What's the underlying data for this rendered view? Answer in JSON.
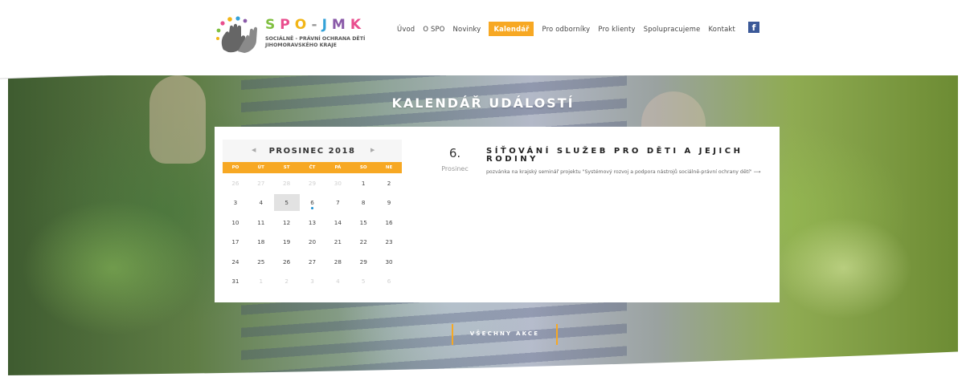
{
  "logo": {
    "title_letters": [
      "S",
      "P",
      "O",
      "-",
      "J",
      "M",
      "K"
    ],
    "subtitle_line1": "SOCIÁLNĚ - PRÁVNÍ OCHRANA DĚTÍ",
    "subtitle_line2": "JIHOMORAVSKÉHO KRAJE"
  },
  "nav": {
    "items": [
      "Úvod",
      "O SPO",
      "Novinky",
      "Kalendář",
      "Pro odborníky",
      "Pro klienty",
      "Spolupracujeme",
      "Kontakt"
    ],
    "active": "Kalendář",
    "facebook": "f"
  },
  "hero": {
    "title": "KALENDÁŘ UDÁLOSTÍ"
  },
  "calendar": {
    "title": "PROSINEC 2018",
    "prev": "◀",
    "next": "▶",
    "weekdays": [
      "PO",
      "ÚT",
      "ST",
      "ČT",
      "PÁ",
      "SO",
      "NE"
    ],
    "weeks": [
      [
        "26",
        "27",
        "28",
        "29",
        "30",
        "1",
        "2"
      ],
      [
        "3",
        "4",
        "5",
        "6",
        "7",
        "8",
        "9"
      ],
      [
        "10",
        "11",
        "12",
        "13",
        "14",
        "15",
        "16"
      ],
      [
        "17",
        "18",
        "19",
        "20",
        "21",
        "22",
        "23"
      ],
      [
        "24",
        "25",
        "26",
        "27",
        "28",
        "29",
        "30"
      ],
      [
        "31",
        "1",
        "2",
        "3",
        "4",
        "5",
        "6"
      ]
    ],
    "selected_day": "5",
    "event_day": "6"
  },
  "event": {
    "day": "6.",
    "month": "Prosinec",
    "title": "SÍŤOVÁNÍ SLUŽEB PRO DĚTI A JEJICH RODINY",
    "description": "pozvánka na krajský seminář projektu \"Systémový rozvoj a podpora nástrojů sociálně-právní ochrany dětí\" ⟶"
  },
  "all_events": {
    "label": "VŠECHNY AKCE"
  },
  "colors": {
    "accent": "#f7a823",
    "event_dot": "#1a8fd1",
    "facebook": "#3b5998"
  }
}
